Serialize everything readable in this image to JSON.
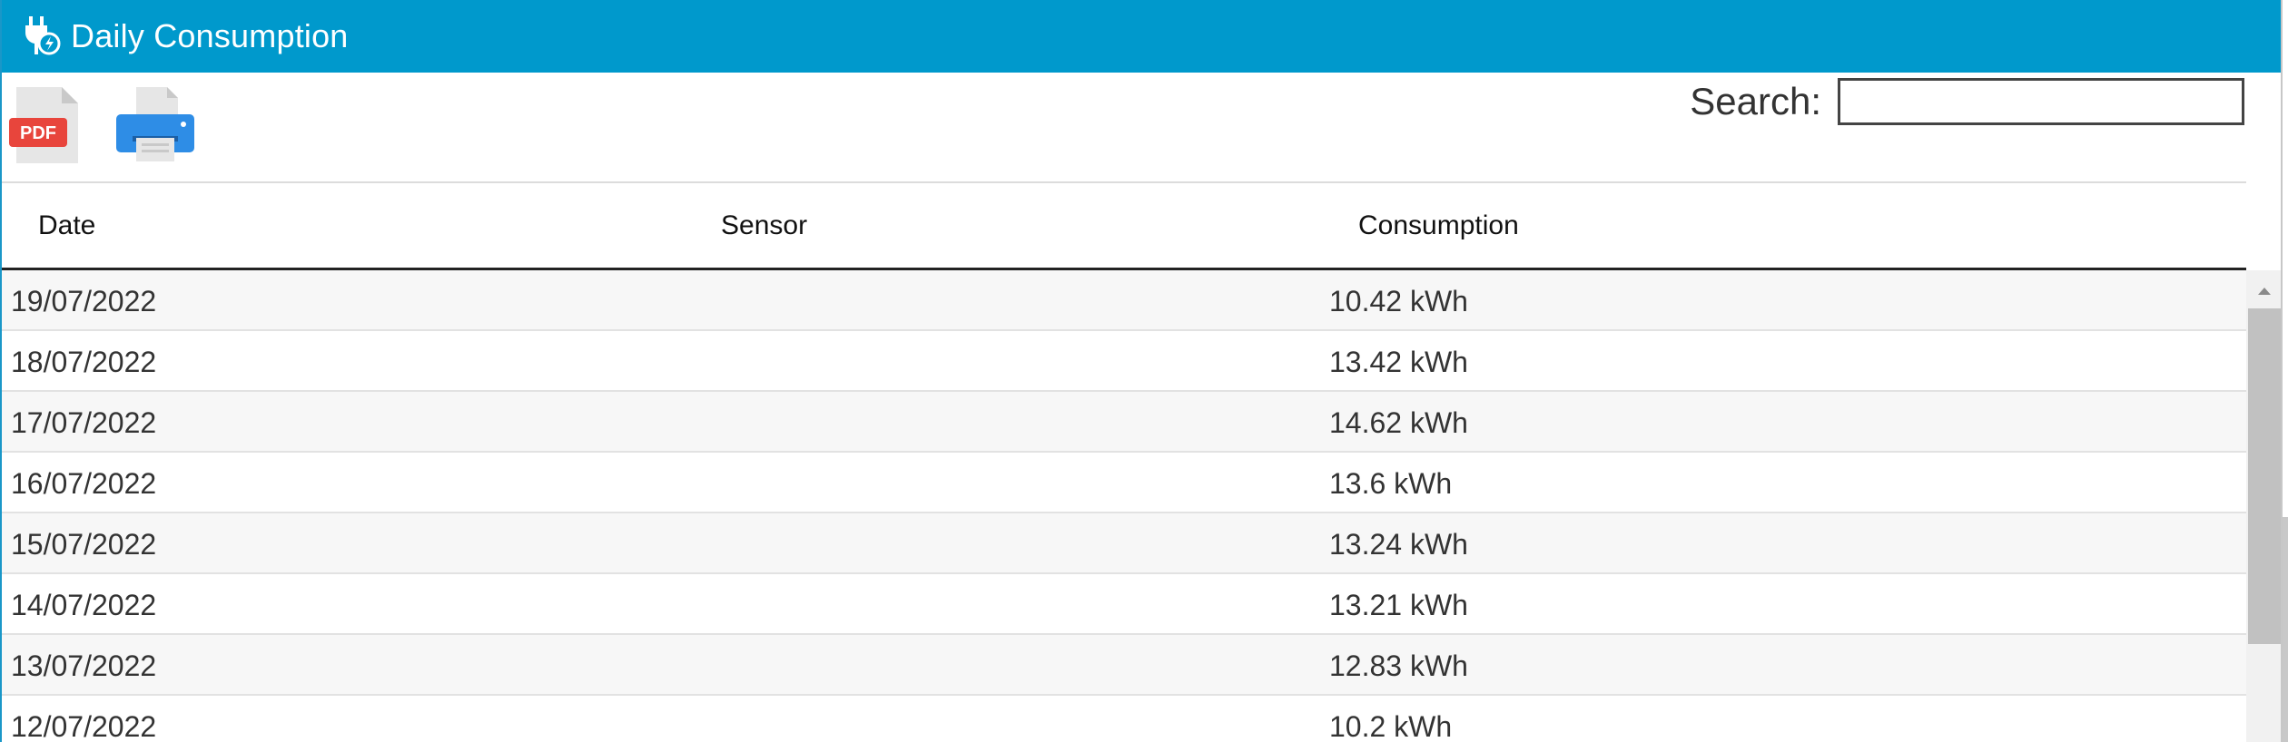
{
  "header": {
    "title": "Daily Consumption",
    "icon": "plug-bolt-icon",
    "background_color": "#0099cc"
  },
  "toolbar": {
    "pdf_icon": "pdf-file-icon",
    "print_icon": "printer-icon",
    "pdf_badge": "PDF"
  },
  "search": {
    "label": "Search:",
    "value": ""
  },
  "table": {
    "columns": [
      "Date",
      "Sensor",
      "Consumption"
    ],
    "rows": [
      {
        "date": "19/07/2022",
        "sensor": "",
        "consumption": "10.42 kWh"
      },
      {
        "date": "18/07/2022",
        "sensor": "",
        "consumption": "13.42 kWh"
      },
      {
        "date": "17/07/2022",
        "sensor": "",
        "consumption": "14.62 kWh"
      },
      {
        "date": "16/07/2022",
        "sensor": "",
        "consumption": "13.6 kWh"
      },
      {
        "date": "15/07/2022",
        "sensor": "",
        "consumption": "13.24 kWh"
      },
      {
        "date": "14/07/2022",
        "sensor": "",
        "consumption": "13.21 kWh"
      },
      {
        "date": "13/07/2022",
        "sensor": "",
        "consumption": "12.83 kWh"
      },
      {
        "date": "12/07/2022",
        "sensor": "",
        "consumption": "10.2 kWh"
      }
    ]
  }
}
